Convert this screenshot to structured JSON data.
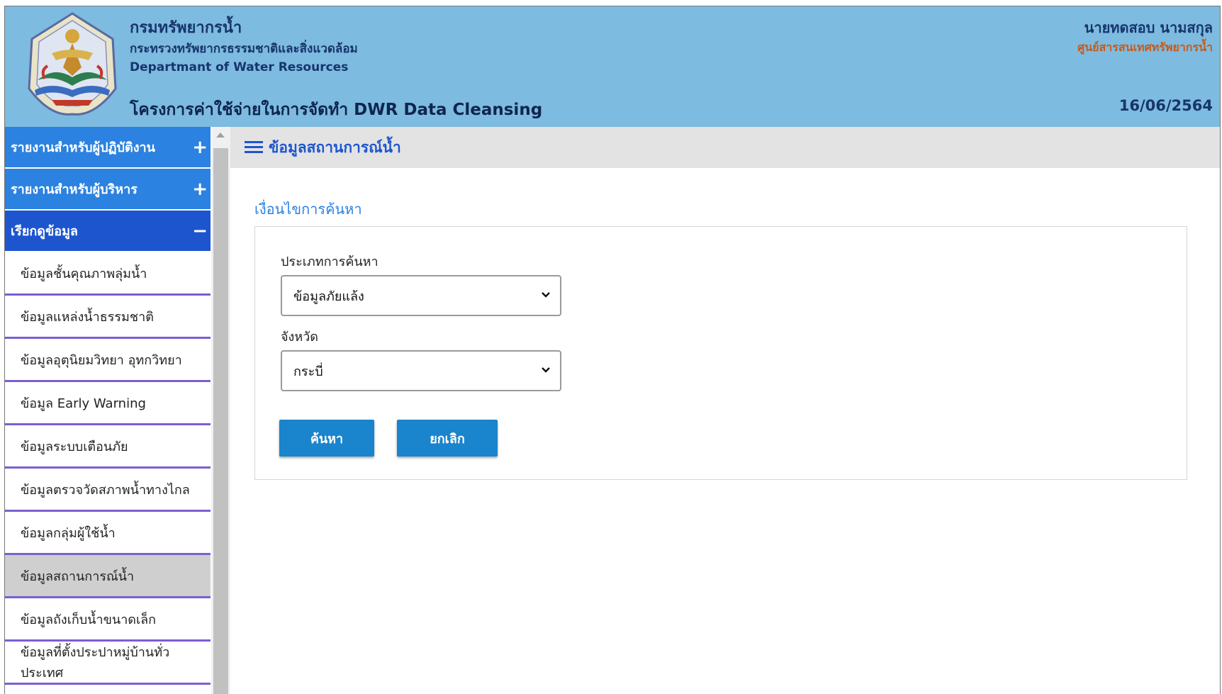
{
  "header": {
    "org_name_th": "กรมทรัพยากรน้ำ",
    "ministry_th": "กระทรวงทรัพยากรธรรมชาติและสิ่งแวดล้อม",
    "dept_en": "Departmant of Water Resources",
    "project_title": "โครงการค่าใช้จ่ายในการจัดทำ DWR Data Cleansing",
    "user_name": "นายทดสอบ นามสกุล",
    "user_unit": "ศูนย์สารสนเทศทรัพยากรน้ำ",
    "date": "16/06/2564",
    "logo_text": "DEPARTMENT OF WATER RESOURCES"
  },
  "sidebar": {
    "groups": [
      {
        "label": "รายงานสำหรับผู้ปฏิบัติงาน",
        "toggle": "+"
      },
      {
        "label": "รายงานสำหรับผู้บริหาร",
        "toggle": "+"
      },
      {
        "label": "เรียกดูข้อมูล",
        "toggle": "−"
      }
    ],
    "items": [
      {
        "label": "ข้อมูลชั้นคุณภาพลุ่มน้ำ"
      },
      {
        "label": "ข้อมูลแหล่งน้ำธรรมชาติ"
      },
      {
        "label": "ข้อมูลอุตุนิยมวิทยา อุทกวิทยา"
      },
      {
        "label": "ข้อมูล Early Warning"
      },
      {
        "label": "ข้อมูลระบบเตือนภัย"
      },
      {
        "label": "ข้อมูลตรวจวัดสภาพน้ำทางไกล"
      },
      {
        "label": "ข้อมูลกลุ่มผู้ใช้น้ำ"
      },
      {
        "label": "ข้อมูลสถานการณ์น้ำ"
      },
      {
        "label": "ข้อมูลถังเก็บน้ำขนาดเล็ก"
      },
      {
        "label": "ข้อมูลที่ตั้งประปาหมู่บ้านทั่วประเทศ"
      }
    ],
    "selected_index": 7
  },
  "main": {
    "title": "ข้อมูลสถานการณ์น้ำ",
    "section_title": "เงื่อนไขการค้นหา",
    "search_type_label": "ประเภทการค้นหา",
    "search_type_value": "ข้อมูลภัยแล้ง",
    "province_label": "จังหวัด",
    "province_value": "กระบี่",
    "search_button": "ค้นหา",
    "cancel_button": "ยกเลิก"
  },
  "icons": {
    "logo": "dwr-emblem-icon",
    "hamburger": "hamburger-menu-icon",
    "dropdown": "chevron-down-icon"
  },
  "colors": {
    "header_bg": "#7dbbe0",
    "menu_group_bg": "#2b82e0",
    "menu_group_active_bg": "#1d55cf",
    "menu_item_border": "#7b5fd0",
    "selected_item_bg": "#cfcfcf",
    "button_bg": "#1a84cc",
    "user_unit_text": "#c85a1a"
  }
}
